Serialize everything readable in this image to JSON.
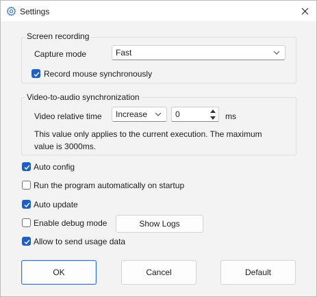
{
  "window": {
    "title": "Settings",
    "title_icon": "gear-icon",
    "close_icon": "close-icon"
  },
  "screen_recording": {
    "group_title": "Screen recording",
    "capture_mode_label": "Capture mode",
    "capture_mode_value": "Fast",
    "record_mouse_label": "Record mouse synchronously",
    "record_mouse_checked": true
  },
  "sync": {
    "group_title": "Video-to-audio synchronization",
    "relative_time_label": "Video relative time",
    "direction_value": "Increase",
    "offset_value": "0",
    "unit": "ms",
    "note": "This value only applies to the current execution. The maximum value is 3000ms."
  },
  "options": {
    "auto_config": {
      "label": "Auto config",
      "checked": true
    },
    "run_on_startup": {
      "label": "Run the program automatically on startup",
      "checked": false
    },
    "auto_update": {
      "label": "Auto update",
      "checked": true
    },
    "debug_mode": {
      "label": "Enable debug mode",
      "checked": false
    },
    "usage_data": {
      "label": "Allow to send usage data",
      "checked": true
    },
    "show_logs_label": "Show Logs"
  },
  "buttons": {
    "ok": "OK",
    "cancel": "Cancel",
    "default": "Default"
  },
  "colors": {
    "accent": "#1f5fbd",
    "window_bg": "#f3f3f3"
  }
}
